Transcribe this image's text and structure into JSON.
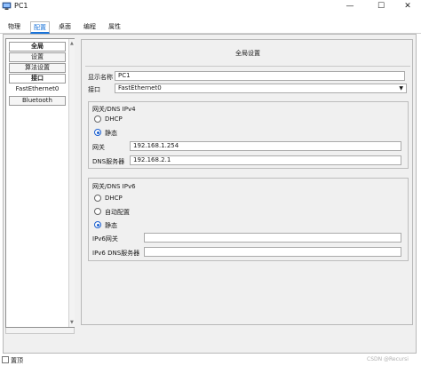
{
  "window": {
    "title": "PC1",
    "minimize": "—",
    "maximize": "☐",
    "close": "✕"
  },
  "tabs": [
    "物理",
    "配置",
    "桌面",
    "编程",
    "属性"
  ],
  "sidebar": {
    "items": [
      {
        "label": "全局",
        "style": "header"
      },
      {
        "label": "设置",
        "style": "button"
      },
      {
        "label": "算法设置",
        "style": "button"
      },
      {
        "label": "接口",
        "style": "header"
      },
      {
        "label": "FastEthernet0",
        "style": "plain"
      },
      {
        "label": "Bluetooth",
        "style": "button"
      }
    ]
  },
  "main": {
    "title": "全局设置",
    "display_name_label": "显示名称",
    "display_name_value": "PC1",
    "interface_label": "接口",
    "interface_value": "FastEthernet0",
    "ipv4": {
      "title": "网关/DNS IPv4",
      "dhcp": "DHCP",
      "static": "静态",
      "gateway_label": "网关",
      "gateway_value": "192.168.1.254",
      "dns_label": "DNS服务器",
      "dns_value": "192.168.2.1"
    },
    "ipv6": {
      "title": "网关/DNS IPv6",
      "dhcp": "DHCP",
      "auto": "自动配置",
      "static": "静态",
      "gateway_label": "IPv6网关",
      "gateway_value": "",
      "dns_label": "IPv6 DNS服务器",
      "dns_value": ""
    }
  },
  "footer": {
    "checkbox_label": "置顶"
  },
  "watermark": "CSDN @Recursi"
}
